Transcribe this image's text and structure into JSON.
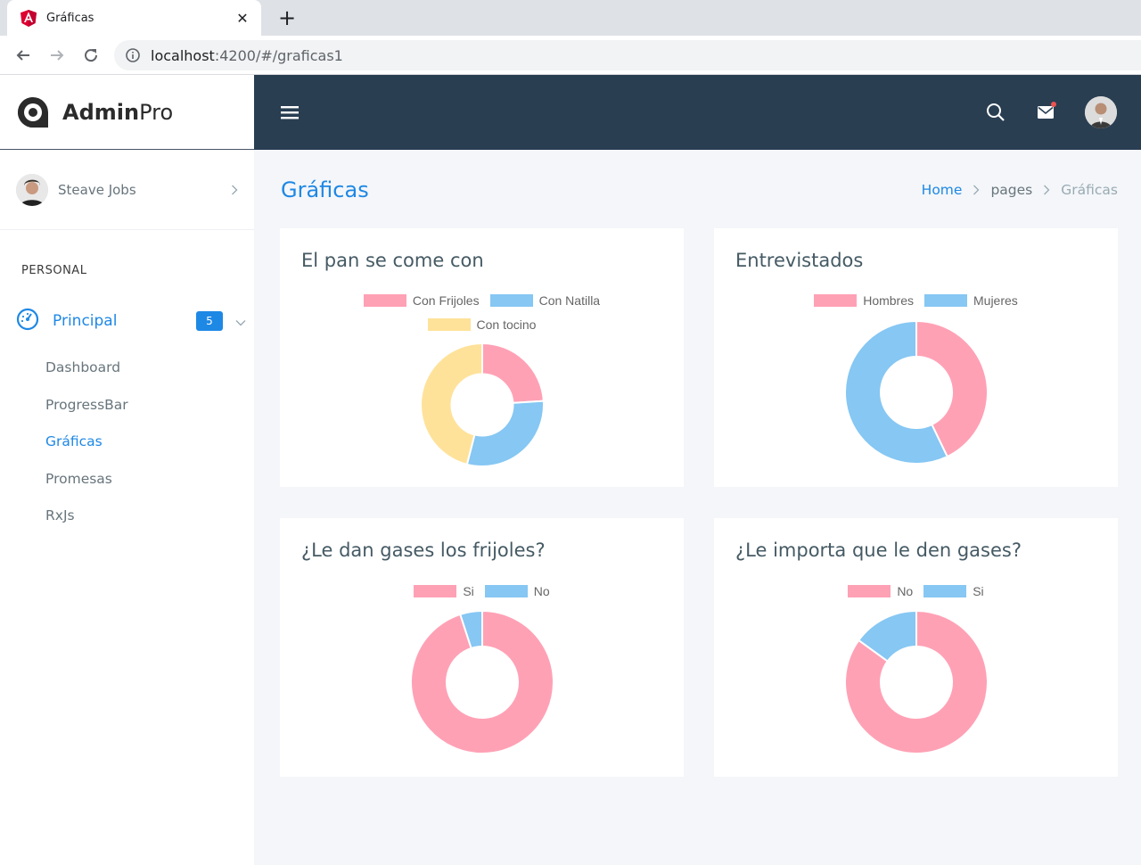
{
  "browser": {
    "tab_title": "Gráficas",
    "url_host": "localhost",
    "url_path": ":4200/#/graficas1"
  },
  "brand": {
    "bold": "Admin",
    "light": "Pro"
  },
  "user": {
    "name": "Steave Jobs"
  },
  "sidebar": {
    "section": "PERSONAL",
    "main_label": "Principal",
    "badge": "5",
    "items": [
      "Dashboard",
      "ProgressBar",
      "Gráficas",
      "Promesas",
      "RxJs"
    ]
  },
  "page": {
    "title": "Gráficas",
    "breadcrumb": [
      "Home",
      "pages",
      "Gráficas"
    ]
  },
  "colors": {
    "pink": "#ffa1b5",
    "blue": "#86c7f3",
    "yellow": "#ffe29a",
    "accent": "#1e88e5",
    "topbar": "#2a3e52"
  },
  "chart_data": [
    {
      "type": "pie",
      "title": "El pan se come con",
      "categories": [
        "Con Frijoles",
        "Con Natilla",
        "Con tocino"
      ],
      "values": [
        24,
        30,
        46
      ],
      "colors": [
        "#ffa1b5",
        "#86c7f3",
        "#ffe29a"
      ]
    },
    {
      "type": "pie",
      "title": "Entrevistados",
      "categories": [
        "Hombres",
        "Mujeres"
      ],
      "values": [
        4500,
        6000
      ],
      "colors": [
        "#ffa1b5",
        "#86c7f3"
      ]
    },
    {
      "type": "pie",
      "title": "¿Le dan gases los frijoles?",
      "categories": [
        "Si",
        "No"
      ],
      "values": [
        95,
        5
      ],
      "colors": [
        "#ffa1b5",
        "#86c7f3"
      ]
    },
    {
      "type": "pie",
      "title": "¿Le importa que le den gases?",
      "categories": [
        "No",
        "Si"
      ],
      "values": [
        85,
        15
      ],
      "colors": [
        "#ffa1b5",
        "#86c7f3"
      ]
    }
  ]
}
